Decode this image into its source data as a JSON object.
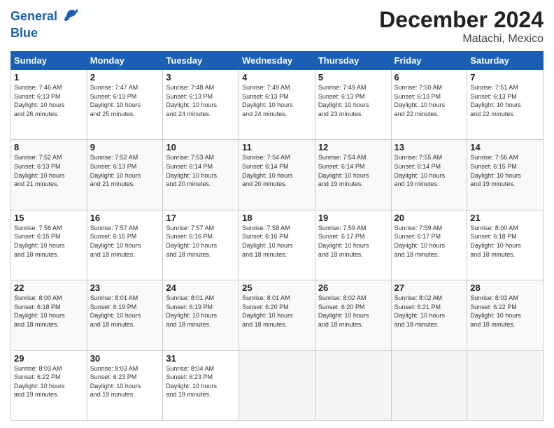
{
  "logo": {
    "line1": "General",
    "line2": "Blue"
  },
  "title": "December 2024",
  "location": "Matachi, Mexico",
  "days_of_week": [
    "Sunday",
    "Monday",
    "Tuesday",
    "Wednesday",
    "Thursday",
    "Friday",
    "Saturday"
  ],
  "weeks": [
    [
      {
        "day": "1",
        "info": "Sunrise: 7:46 AM\nSunset: 6:13 PM\nDaylight: 10 hours\nand 26 minutes."
      },
      {
        "day": "2",
        "info": "Sunrise: 7:47 AM\nSunset: 6:13 PM\nDaylight: 10 hours\nand 25 minutes."
      },
      {
        "day": "3",
        "info": "Sunrise: 7:48 AM\nSunset: 6:13 PM\nDaylight: 10 hours\nand 24 minutes."
      },
      {
        "day": "4",
        "info": "Sunrise: 7:49 AM\nSunset: 6:13 PM\nDaylight: 10 hours\nand 24 minutes."
      },
      {
        "day": "5",
        "info": "Sunrise: 7:49 AM\nSunset: 6:13 PM\nDaylight: 10 hours\nand 23 minutes."
      },
      {
        "day": "6",
        "info": "Sunrise: 7:50 AM\nSunset: 6:13 PM\nDaylight: 10 hours\nand 22 minutes."
      },
      {
        "day": "7",
        "info": "Sunrise: 7:51 AM\nSunset: 6:13 PM\nDaylight: 10 hours\nand 22 minutes."
      }
    ],
    [
      {
        "day": "8",
        "info": "Sunrise: 7:52 AM\nSunset: 6:13 PM\nDaylight: 10 hours\nand 21 minutes."
      },
      {
        "day": "9",
        "info": "Sunrise: 7:52 AM\nSunset: 6:13 PM\nDaylight: 10 hours\nand 21 minutes."
      },
      {
        "day": "10",
        "info": "Sunrise: 7:53 AM\nSunset: 6:14 PM\nDaylight: 10 hours\nand 20 minutes."
      },
      {
        "day": "11",
        "info": "Sunrise: 7:54 AM\nSunset: 6:14 PM\nDaylight: 10 hours\nand 20 minutes."
      },
      {
        "day": "12",
        "info": "Sunrise: 7:54 AM\nSunset: 6:14 PM\nDaylight: 10 hours\nand 19 minutes."
      },
      {
        "day": "13",
        "info": "Sunrise: 7:55 AM\nSunset: 6:14 PM\nDaylight: 10 hours\nand 19 minutes."
      },
      {
        "day": "14",
        "info": "Sunrise: 7:56 AM\nSunset: 6:15 PM\nDaylight: 10 hours\nand 19 minutes."
      }
    ],
    [
      {
        "day": "15",
        "info": "Sunrise: 7:56 AM\nSunset: 6:15 PM\nDaylight: 10 hours\nand 18 minutes."
      },
      {
        "day": "16",
        "info": "Sunrise: 7:57 AM\nSunset: 6:15 PM\nDaylight: 10 hours\nand 18 minutes."
      },
      {
        "day": "17",
        "info": "Sunrise: 7:57 AM\nSunset: 6:16 PM\nDaylight: 10 hours\nand 18 minutes."
      },
      {
        "day": "18",
        "info": "Sunrise: 7:58 AM\nSunset: 6:16 PM\nDaylight: 10 hours\nand 18 minutes."
      },
      {
        "day": "19",
        "info": "Sunrise: 7:59 AM\nSunset: 6:17 PM\nDaylight: 10 hours\nand 18 minutes."
      },
      {
        "day": "20",
        "info": "Sunrise: 7:59 AM\nSunset: 6:17 PM\nDaylight: 10 hours\nand 18 minutes."
      },
      {
        "day": "21",
        "info": "Sunrise: 8:00 AM\nSunset: 6:18 PM\nDaylight: 10 hours\nand 18 minutes."
      }
    ],
    [
      {
        "day": "22",
        "info": "Sunrise: 8:00 AM\nSunset: 6:18 PM\nDaylight: 10 hours\nand 18 minutes."
      },
      {
        "day": "23",
        "info": "Sunrise: 8:01 AM\nSunset: 6:19 PM\nDaylight: 10 hours\nand 18 minutes."
      },
      {
        "day": "24",
        "info": "Sunrise: 8:01 AM\nSunset: 6:19 PM\nDaylight: 10 hours\nand 18 minutes."
      },
      {
        "day": "25",
        "info": "Sunrise: 8:01 AM\nSunset: 6:20 PM\nDaylight: 10 hours\nand 18 minutes."
      },
      {
        "day": "26",
        "info": "Sunrise: 8:02 AM\nSunset: 6:20 PM\nDaylight: 10 hours\nand 18 minutes."
      },
      {
        "day": "27",
        "info": "Sunrise: 8:02 AM\nSunset: 6:21 PM\nDaylight: 10 hours\nand 18 minutes."
      },
      {
        "day": "28",
        "info": "Sunrise: 8:03 AM\nSunset: 6:22 PM\nDaylight: 10 hours\nand 18 minutes."
      }
    ],
    [
      {
        "day": "29",
        "info": "Sunrise: 8:03 AM\nSunset: 6:22 PM\nDaylight: 10 hours\nand 19 minutes."
      },
      {
        "day": "30",
        "info": "Sunrise: 8:03 AM\nSunset: 6:23 PM\nDaylight: 10 hours\nand 19 minutes."
      },
      {
        "day": "31",
        "info": "Sunrise: 8:04 AM\nSunset: 6:23 PM\nDaylight: 10 hours\nand 19 minutes."
      },
      {
        "day": "",
        "info": ""
      },
      {
        "day": "",
        "info": ""
      },
      {
        "day": "",
        "info": ""
      },
      {
        "day": "",
        "info": ""
      }
    ]
  ]
}
